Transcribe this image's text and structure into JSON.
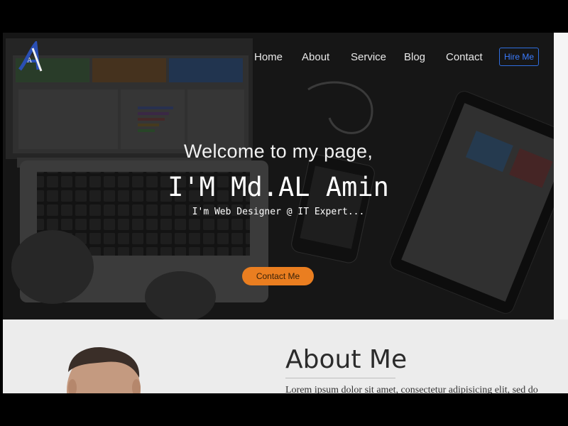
{
  "nav": {
    "logo_letter": "A",
    "items": [
      {
        "label": "Home"
      },
      {
        "label": "About"
      },
      {
        "label": "Service"
      },
      {
        "label": "Blog"
      },
      {
        "label": "Contact"
      }
    ],
    "hire_label": "Hire Me"
  },
  "hero": {
    "welcome": "Welcome to my page,",
    "name": "I'M Md.AL Amin",
    "role": "I'm Web Designer @ IT Expert...",
    "contact_label": "Contact Me"
  },
  "about": {
    "title": "About Me",
    "text": "Lorem ipsum dolor sit amet, consectetur adipisicing elit, sed do"
  },
  "colors": {
    "accent_orange": "#ea7e20",
    "hire_blue": "#2f6ee0",
    "hero_overlay": "#262626",
    "about_bg": "#ececec"
  }
}
